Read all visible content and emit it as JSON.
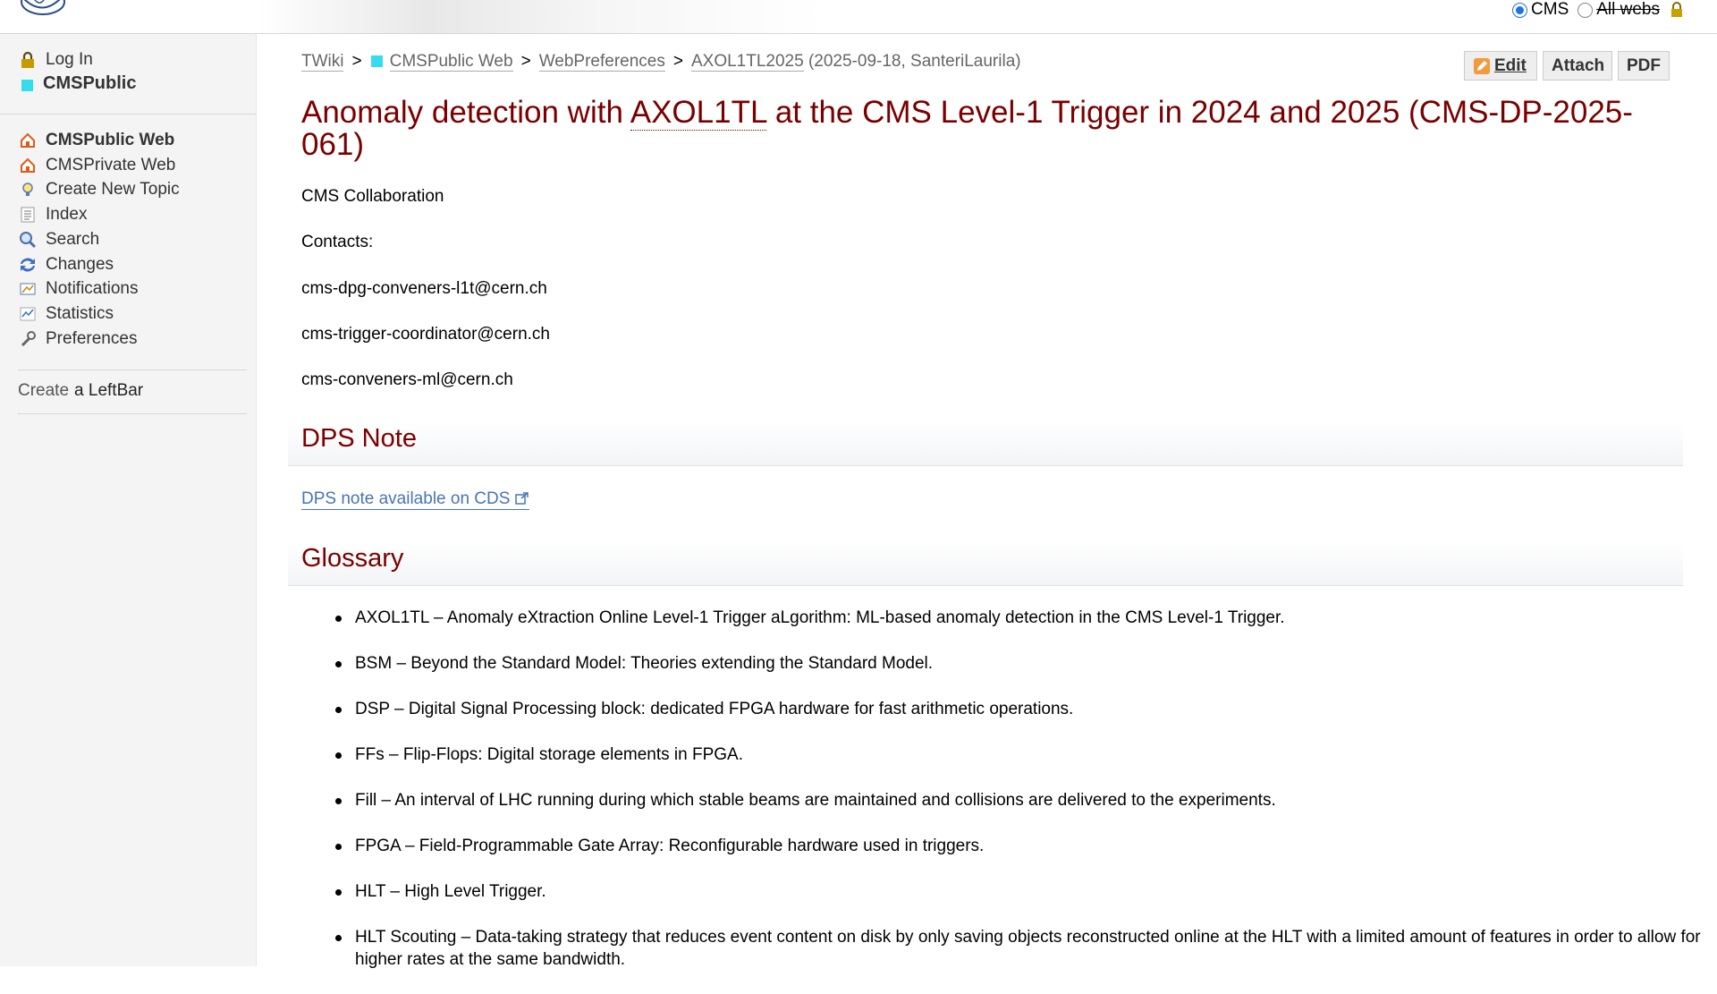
{
  "topbar": {
    "scope_cms": "CMS",
    "scope_all": "All webs"
  },
  "sidebar": {
    "login": "Log In",
    "web_name": "CMSPublic",
    "nav": [
      {
        "label": "CMSPublic Web",
        "icon": "home-icon",
        "bold": true
      },
      {
        "label": "CMSPrivate Web",
        "icon": "home-icon",
        "bold": false
      },
      {
        "label": "Create New Topic",
        "icon": "lightbulb-icon",
        "bold": false
      },
      {
        "label": "Index",
        "icon": "index-icon",
        "bold": false
      },
      {
        "label": "Search",
        "icon": "search-icon",
        "bold": false
      },
      {
        "label": "Changes",
        "icon": "changes-icon",
        "bold": false
      },
      {
        "label": "Notifications",
        "icon": "notify-icon",
        "bold": false
      },
      {
        "label": "Statistics",
        "icon": "statistics-icon",
        "bold": false
      },
      {
        "label": "Preferences",
        "icon": "wrench-icon",
        "bold": false
      }
    ],
    "create_prefix": "Create",
    "create_link": "a LeftBar"
  },
  "breadcrumb": {
    "items": [
      "TWiki",
      "CMSPublic Web",
      "WebPreferences",
      "AXOL1TL2025"
    ],
    "separator": ">",
    "meta": "(2025-09-18, SanteriLaurila)"
  },
  "toolbar": {
    "edit": "Edit",
    "attach": "Attach",
    "pdf": "PDF"
  },
  "page": {
    "title_pre": "Anomaly detection with ",
    "title_abbr": "AXOL1TL",
    "title_post": " at the CMS Level-1 Trigger in 2024 and 2025 (CMS-DP-2025-061)",
    "collab": "CMS Collaboration",
    "contacts_label": "Contacts:",
    "contacts": [
      "cms-dpg-conveners-l1t@cern.ch",
      "cms-trigger-coordinator@cern.ch",
      "cms-conveners-ml@cern.ch"
    ],
    "dps_heading": "DPS Note",
    "dps_link": "DPS note available on CDS",
    "glossary_heading": "Glossary",
    "glossary": [
      "AXOL1TL – Anomaly eXtraction Online Level-1 Trigger aLgorithm: ML-based anomaly detection in the CMS Level-1 Trigger.",
      "BSM – Beyond the Standard Model: Theories extending the Standard Model.",
      "DSP – Digital Signal Processing block: dedicated FPGA hardware for fast arithmetic operations.",
      "FFs – Flip-Flops: Digital storage elements in FPGA.",
      "Fill – An interval of LHC running during which stable beams are maintained and collisions are delivered to the experiments.",
      "FPGA – Field-Programmable Gate Array: Reconfigurable hardware used in triggers.",
      "HLT – High Level Trigger.",
      "HLT Scouting – Data-taking strategy that reduces event content on disk by only saving objects reconstructed online at the HLT with a limited amount of features in order to allow for higher rates at the same bandwidth."
    ]
  },
  "colors": {
    "title": "#7a0000",
    "link": "#4775b8",
    "web_square": "#33ddee"
  }
}
